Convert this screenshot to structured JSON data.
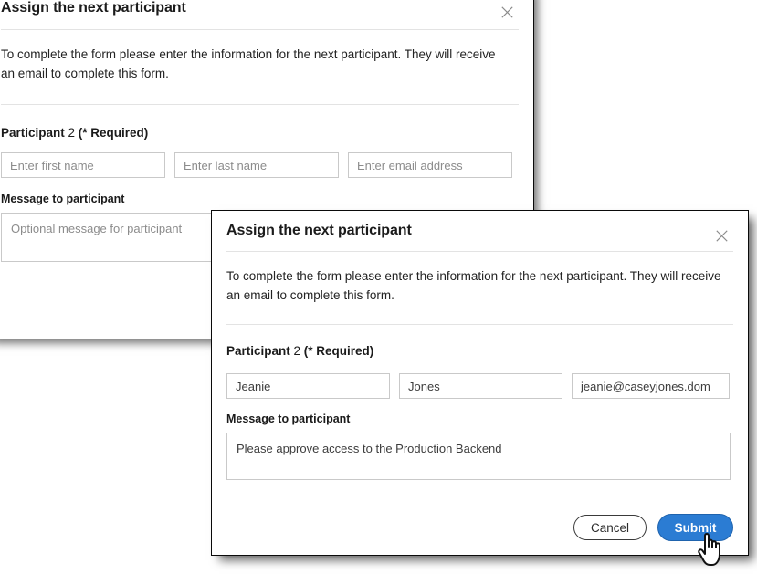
{
  "back_dialog": {
    "title": "Assign the next participant",
    "close_icon": "close-icon",
    "description": "To complete the form please enter the information for the next participant. They will receive an email to complete this form.",
    "section_label_bold": "Participant",
    "section_label_number": " 2 ",
    "section_label_required": "(* Required)",
    "fields": {
      "first_name_placeholder": "Enter first name",
      "first_name_value": "",
      "last_name_placeholder": "Enter last name",
      "last_name_value": "",
      "email_placeholder": "Enter email address",
      "email_value": ""
    },
    "message_label": "Message to participant",
    "message_placeholder": "Optional message for participant",
    "message_value": ""
  },
  "front_dialog": {
    "title": "Assign the next participant",
    "close_icon": "close-icon",
    "description": "To complete the form please enter the information for the next participant. They will receive an email to complete this form.",
    "section_label_bold": "Participant",
    "section_label_number": " 2 ",
    "section_label_required": "(* Required)",
    "fields": {
      "first_name_placeholder": "Enter first name",
      "first_name_value": "Jeanie",
      "last_name_placeholder": "Enter last name",
      "last_name_value": "Jones",
      "email_placeholder": "Enter email address",
      "email_value": "jeanie@caseyjones.dom"
    },
    "message_label": "Message to participant",
    "message_placeholder": "Optional message for participant",
    "message_value": "Please approve access to the Production Backend",
    "footer": {
      "cancel_label": "Cancel",
      "submit_label": "Submit"
    }
  },
  "cursor": {
    "icon": "pointing-hand-cursor"
  },
  "colors": {
    "submit_blue": "#2b7cd3",
    "dialog_border": "#0a0a0a",
    "divider": "#e3e3e3",
    "input_border": "#c9c9c9",
    "placeholder": "#8c8c8c",
    "text": "#1b1b1b"
  }
}
